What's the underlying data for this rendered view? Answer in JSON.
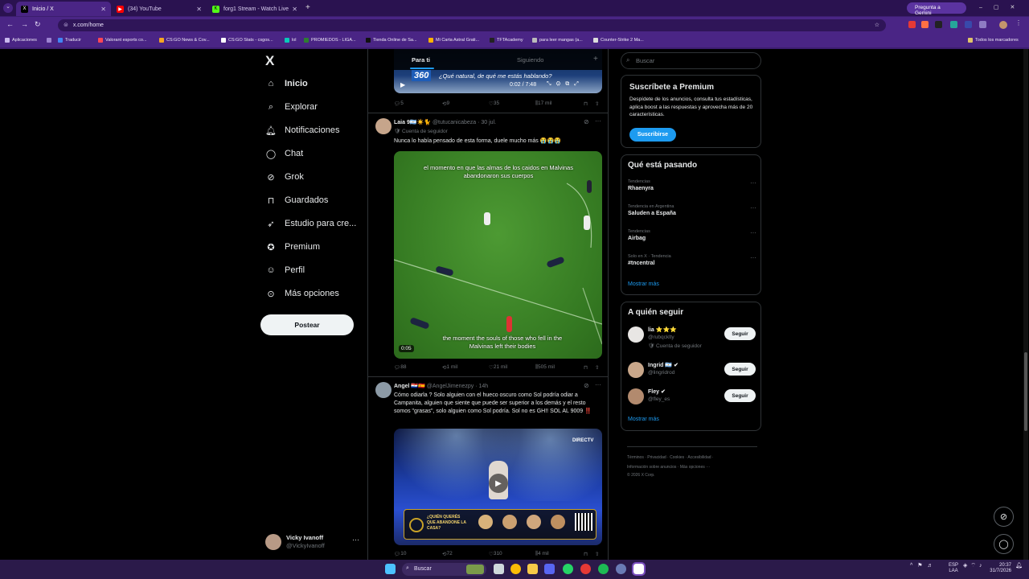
{
  "browser": {
    "tabs": [
      {
        "title": "Inicio / X",
        "icon": "x-icon",
        "active": true
      },
      {
        "title": "(34) YouTube",
        "icon": "youtube-icon",
        "active": false
      },
      {
        "title": "forg1 Stream - Watch Live",
        "icon": "kick-icon",
        "active": false
      }
    ],
    "new_tab": "+",
    "gemini_label": "Pregunta a Gemini",
    "url": "x.com/home",
    "bookmarks": [
      "Aplicaciones",
      "Traducir",
      "Valorant esports co...",
      "CS:GO News & Cov...",
      "CS:GO Stats - csgos...",
      "lol",
      "PROMIEDOS - LIGA...",
      "Tienda Online de Sa...",
      "Mi Carta Astral Grati...",
      "TFTAcademy",
      "para leer mangas (a...",
      "Counter-Strike 2 Ma..."
    ],
    "all_bookmarks": "Todos los marcadores"
  },
  "nav": {
    "logo": "X",
    "items": [
      {
        "label": "Inicio",
        "icon": "home-icon"
      },
      {
        "label": "Explorar",
        "icon": "search-icon"
      },
      {
        "label": "Notificaciones",
        "icon": "bell-icon"
      },
      {
        "label": "Chat",
        "icon": "chat-icon"
      },
      {
        "label": "Grok",
        "icon": "grok-icon"
      },
      {
        "label": "Guardados",
        "icon": "bookmark-icon"
      },
      {
        "label": "Estudio para cre...",
        "icon": "rocket-icon"
      },
      {
        "label": "Premium",
        "icon": "premium-icon"
      },
      {
        "label": "Perfil",
        "icon": "person-icon"
      },
      {
        "label": "Más opciones",
        "icon": "more-icon"
      }
    ],
    "post_button": "Postear",
    "account": {
      "name": "Vicky Ivanoff",
      "handle": "@VickyIvanoff",
      "more": "···"
    }
  },
  "feed": {
    "tabs": [
      "Para ti",
      "Siguiendo"
    ],
    "top_video": {
      "caption": "¿Qué natural, de qué me estás hablando?",
      "time": "0:02 / 7:48",
      "badge": "360"
    },
    "top_actions": {
      "replies": "5",
      "reposts": "9",
      "likes": "35",
      "views": "17 mil"
    },
    "tweet1": {
      "name": "Laia 9🇦🇷☀️🐈",
      "handle": "@tutucanicabeza",
      "date": "· 30 jul.",
      "badge": "🛡 Cuenta de seguidor",
      "text": "Nunca lo había pensado de esta forma, duele mucho más 😭😭😭",
      "media_top_text": "el momento en que las almas de los caidos en Malvinas abandonaron sus cuerpos",
      "media_bottom_text": "the moment the souls of those who fell in the Malvinas left their bodies",
      "duration": "0:05",
      "replies": "88",
      "reposts": "1 mil",
      "likes": "21 mil",
      "views": "505 mil"
    },
    "tweet2": {
      "name": "Angel 🇵🇾🇪🇸",
      "handle": "@AngelJimenezpy",
      "date": "· 14h",
      "text": "Cómo odiarla ? Solo alguien con el hueco oscuro como Sol podría odiar a Campanita, alguien que siente que puede ser superior a los demás y el resto somos \"grasas\", solo alguien como Sol podría. Sol no es GH!! SOL AL 9009 ‼️",
      "media_banner": "¿QUIÉN QUERÉS QUE ABANDONE LA CASA?",
      "media_logo": "DIRECTV",
      "replies": "10",
      "reposts": "72",
      "likes": "310",
      "views": "4 mil"
    }
  },
  "sidebar": {
    "search_placeholder": "Buscar",
    "premium": {
      "title": "Suscríbete a Premium",
      "text": "Despídete de los anuncios, consulta tus estadísticas, aplica boost a las respuestas y aprovecha más de 20 características.",
      "button": "Suscribirse"
    },
    "trends": {
      "title": "Qué está pasando",
      "items": [
        {
          "context": "Tendencias",
          "topic": "Rhaenyra"
        },
        {
          "context": "Tendencia en Argentina",
          "topic": "Saluden a España"
        },
        {
          "context": "Tendencias",
          "topic": "Airbag"
        },
        {
          "context": "Solo en X · Tendencia",
          "topic": "#tncentral"
        }
      ],
      "more": "Mostrar más"
    },
    "follow": {
      "title": "A quién seguir",
      "items": [
        {
          "name": "lia ⭐⭐⭐",
          "handle": "@rubqcklty",
          "sub": "🛡 Cuenta de seguidor",
          "button": "Seguir"
        },
        {
          "name": "Ingrid 🇦🇷 ✔",
          "handle": "@lingridrod",
          "sub": "",
          "button": "Seguir"
        },
        {
          "name": "Fley ✔",
          "handle": "@fley_es",
          "sub": "",
          "button": "Seguir"
        }
      ],
      "more": "Mostrar más"
    },
    "footer": [
      "Términos",
      "Privacidad",
      "Cookies",
      "Accesibilidad",
      "Información sobre anuncios",
      "Más opciones ···",
      "© 2026 X Corp."
    ]
  },
  "taskbar": {
    "search": "Buscar",
    "lang": "ESP",
    "lang2": "LAA",
    "time": "20:37",
    "date": "31/7/2026"
  },
  "colors": {
    "accent": "#1d9bf0",
    "chrome": "#4a2585",
    "pitch": "#3e8a2a"
  }
}
